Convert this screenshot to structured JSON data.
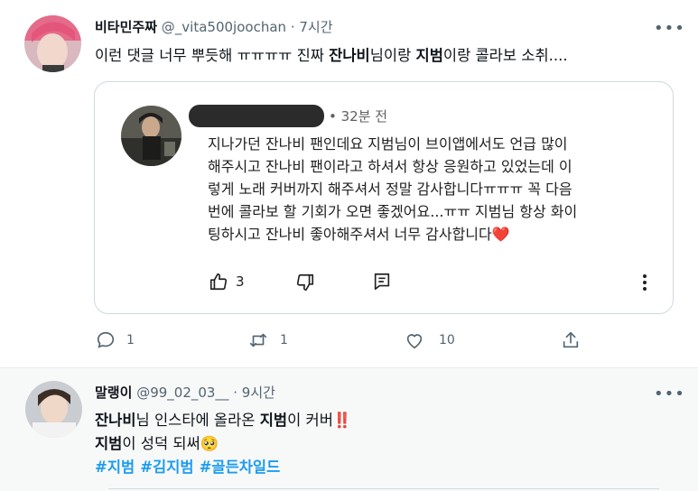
{
  "tweet1": {
    "display_name": "비타민주짜",
    "handle": "@_vita500joochan",
    "time": "· 7시간",
    "text_parts": [
      "이런 댓글 너무 뿌듯해 ㅠㅠㅠㅠ 진짜 ",
      "잔나비",
      "님이랑 ",
      "지범",
      "이랑 콜라보 소취...."
    ],
    "comment": {
      "time": "• 32분 전",
      "text": "지나가던 잔나비 팬인데요 지범님이 브이앱에서도 언급 많이\n해주시고 잔나비 팬이라고 하셔서 항상 응원하고 있었는데 이\n렇게 노래 커버까지 해주셔서 정말 감사합니다ㅠㅠㅠ 꼭 다음\n번에 콜라보 할 기회가 오면 좋겠어요...ㅠㅠ 지범님 항상 화이\n팅하시고 잔나비 좋아해주셔서 너무 감사합니다❤️",
      "like_count": "3"
    },
    "reply_count": "1",
    "retweet_count": "1",
    "like_count": "10"
  },
  "tweet2": {
    "display_name": "말랭이",
    "handle": "@99_02_03__",
    "time": "· 9시간",
    "line1_parts": [
      "잔나비",
      "님 인스타에 올라온 ",
      "지범",
      "이 커버",
      "‼️"
    ],
    "line2_parts": [
      "지범",
      "이 성덕 되써",
      "🥺"
    ],
    "hashtags": [
      "#지범",
      "#김지범",
      "#골든차일드"
    ]
  },
  "icons": {
    "more": "more-dots-icon",
    "reply": "reply-icon",
    "retweet": "retweet-icon",
    "like": "heart-icon",
    "share": "share-icon",
    "thumb_up": "thumbs-up-icon",
    "thumb_down": "thumbs-down-icon",
    "comment_reply": "comment-reply-icon",
    "vertical_more": "vertical-more-icon"
  },
  "colors": {
    "accent": "#1d9bf0",
    "secondary_text": "#536471",
    "heart": "#e0245e"
  }
}
